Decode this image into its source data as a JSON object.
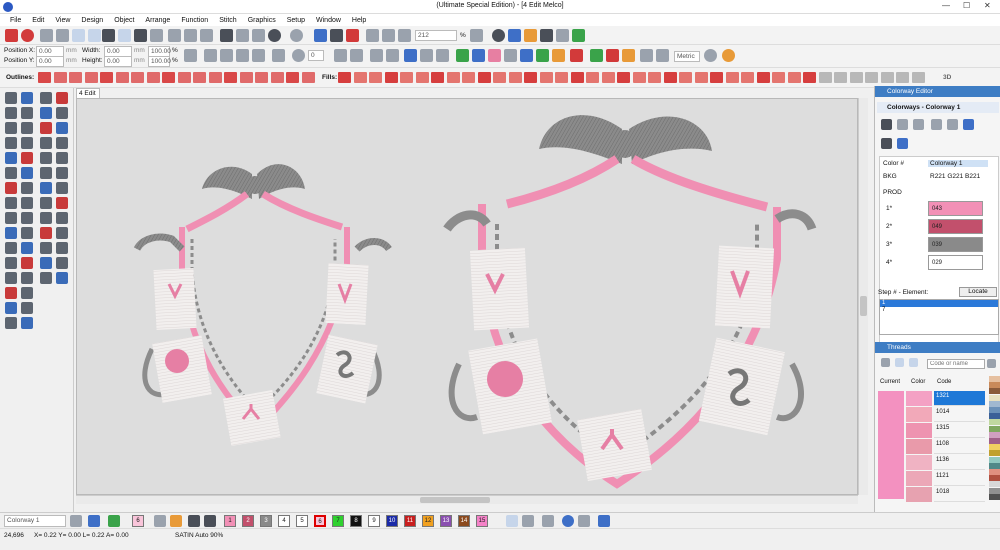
{
  "window": {
    "title": "(Ultimate Special Edition) - [4 Edit    Melco]",
    "minimize": "—",
    "maximize": "☐",
    "close": "✕"
  },
  "menu": [
    "File",
    "Edit",
    "View",
    "Design",
    "Object",
    "Arrange",
    "Function",
    "Stitch",
    "Graphics",
    "Setup",
    "Window",
    "Help"
  ],
  "toolbar": {
    "position_x_label": "Position X:",
    "position_y_label": "Position Y:",
    "position_x": "0.00",
    "position_y": "0.00",
    "width_label": "Width:",
    "height_label": "Height:",
    "width": "0.00",
    "height": "0.00",
    "unit": "mm",
    "pct_w": "100.00",
    "pct_h": "100.00",
    "pct": "%",
    "rotation": "0",
    "zoom_value": "212",
    "zoom_pct": "%",
    "units_select": "Metric",
    "outlines_label": "Outlines:",
    "fills_label": "Fills:",
    "threed": "3D"
  },
  "document_tab": "4 Edit",
  "colorway_editor": {
    "panel_title": "Colorway Editor",
    "header": "Colorways - Colorway 1",
    "col_color": "Color #",
    "col_colorway": "Colorway 1",
    "bkg_label": "BKG",
    "bkg_value": "R221 G221 B221",
    "prod_label": "PROD",
    "rows": [
      {
        "num": "1*",
        "code": "043",
        "color": "#f290b6"
      },
      {
        "num": "2*",
        "code": "049",
        "color": "#c2506c"
      },
      {
        "num": "3*",
        "code": "039",
        "color": "#8a8a8a"
      },
      {
        "num": "4*",
        "code": "029",
        "color": "#ffffff"
      }
    ],
    "step_label": "Step # - Element:",
    "locate_button": "Locate",
    "step_items": [
      "1",
      "7"
    ]
  },
  "threads": {
    "panel_title": "Threads",
    "search_placeholder": "Code or name",
    "col_current": "Current",
    "col_color": "Color",
    "col_code": "Code",
    "rows": [
      {
        "code": "1321",
        "color": "#f4a1c4",
        "selected": true
      },
      {
        "code": "1014",
        "color": "#f2a9b9",
        "selected": false
      },
      {
        "code": "1315",
        "color": "#ee93b0",
        "selected": false
      },
      {
        "code": "1108",
        "color": "#e99aaa",
        "selected": false
      },
      {
        "code": "1136",
        "color": "#f0b3c3",
        "selected": false
      },
      {
        "code": "1121",
        "color": "#eca7b7",
        "selected": false
      },
      {
        "code": "1018",
        "color": "#e7a2b0",
        "selected": false
      }
    ],
    "current_color": "#f391c0"
  },
  "bottom": {
    "colorway_select": "Colorway 1",
    "current_color_num": "6",
    "color_buttons": [
      {
        "label": "1",
        "color": "#f290b6"
      },
      {
        "label": "2",
        "color": "#c2506c"
      },
      {
        "label": "3",
        "color": "#8a8a8a"
      },
      {
        "label": "4",
        "color": "#ffffff"
      },
      {
        "label": "5",
        "color": "#ffffff"
      },
      {
        "label": "6",
        "color": "#f9c5da"
      },
      {
        "label": "7",
        "color": "#2fd12f"
      },
      {
        "label": "8",
        "color": "#111111"
      },
      {
        "label": "9",
        "color": "#ffffff"
      },
      {
        "label": "10",
        "color": "#1b2ba8"
      },
      {
        "label": "11",
        "color": "#c81e1e"
      },
      {
        "label": "12",
        "color": "#f0a020"
      },
      {
        "label": "13",
        "color": "#8a4fb0"
      },
      {
        "label": "14",
        "color": "#8b4a1e"
      },
      {
        "label": "15",
        "color": "#f582c8"
      }
    ]
  },
  "status": {
    "stitch_count": "24,696",
    "coords": "X=  0.22 Y=  0.00 L=  0.22 A=  0.00",
    "mode": "SATIN Auto 90%"
  }
}
